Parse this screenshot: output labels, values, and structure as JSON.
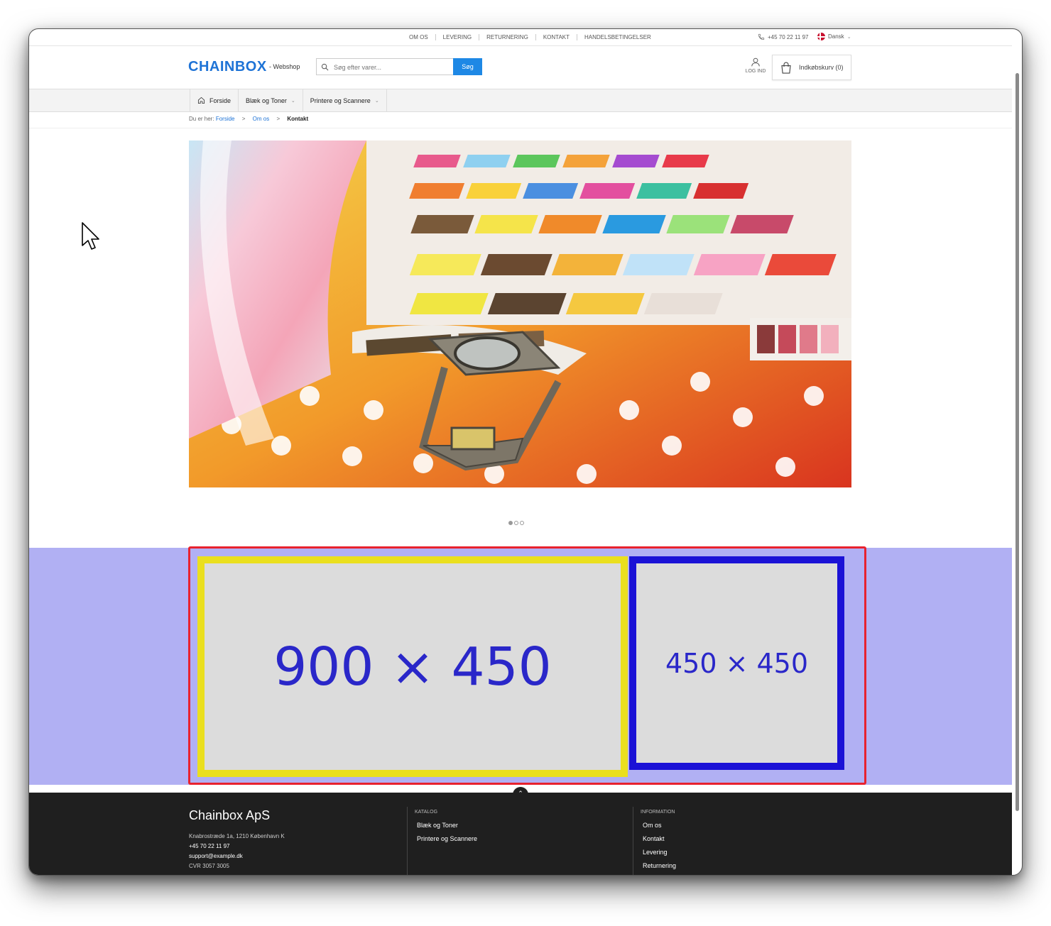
{
  "topbar": {
    "links": [
      "OM OS",
      "LEVERING",
      "RETURNERING",
      "KONTAKT",
      "HANDELSBETINGELSER"
    ],
    "phone": "+45 70 22 11 97",
    "language": "Dansk"
  },
  "header": {
    "logo": "CHAINBOX",
    "tagline": "- Webshop",
    "search_placeholder": "Søg efter varer...",
    "search_button": "Søg",
    "login_label": "LOG IND",
    "cart_label": "Indkøbskurv (0)"
  },
  "nav": {
    "items": [
      {
        "label": "Forside"
      },
      {
        "label": "Blæk og Toner"
      },
      {
        "label": "Printere og Scannere"
      }
    ]
  },
  "breadcrumb": {
    "prefix": "Du er her:",
    "items": [
      "Forside",
      "Om os"
    ],
    "current": "Kontakt",
    "separator": ">"
  },
  "carousel": {
    "slides": 3,
    "active": 1
  },
  "promo": {
    "large_placeholder": "900 × 450",
    "small_placeholder": "450 × 450",
    "colors": {
      "band": "#b1b0f3",
      "red": "#e8222e",
      "yellow": "#eadf1e",
      "blue": "#1b12d6"
    }
  },
  "footer": {
    "company": "Chainbox ApS",
    "address": "Knabrostræde 1a, 1210 København K",
    "phone": "+45 70 22 11 97",
    "email": "support@example.dk",
    "cvr": "CVR 3057 3005",
    "catalog": {
      "heading": "KATALOG",
      "links": [
        "Blæk og Toner",
        "Printere og Scannere"
      ]
    },
    "information": {
      "heading": "INFORMATION",
      "links": [
        "Om os",
        "Kontakt",
        "Levering",
        "Returnering"
      ]
    }
  },
  "colors": {
    "accent": "#1e73d6",
    "button": "#1e88e5",
    "footer_bg": "#1f1f1f"
  }
}
